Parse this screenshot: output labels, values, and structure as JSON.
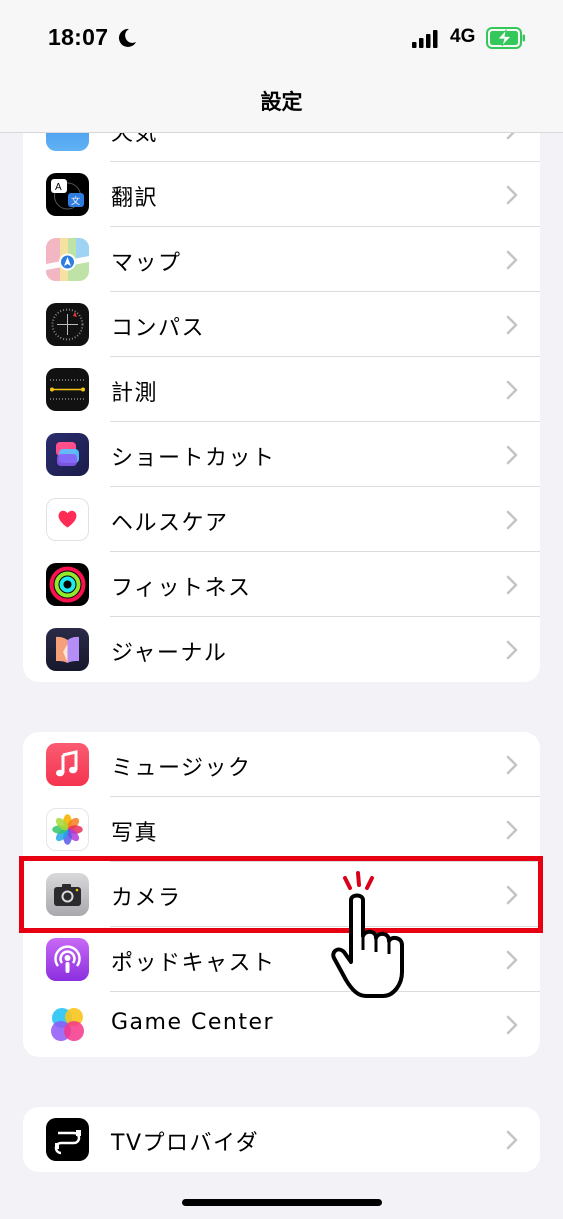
{
  "status_bar": {
    "time": "18:07",
    "network": "4G",
    "focus_icon": "moon-icon",
    "signal_icon": "signal-bars-icon",
    "battery_icon": "battery-charging-icon",
    "battery_color": "#34c759"
  },
  "nav": {
    "title": "設定"
  },
  "groups": [
    {
      "items": [
        {
          "label": "天気",
          "icon": "weather-icon"
        },
        {
          "label": "翻訳",
          "icon": "translate-icon"
        },
        {
          "label": "マップ",
          "icon": "maps-icon"
        },
        {
          "label": "コンパス",
          "icon": "compass-icon"
        },
        {
          "label": "計測",
          "icon": "measure-icon"
        },
        {
          "label": "ショートカット",
          "icon": "shortcuts-icon"
        },
        {
          "label": "ヘルスケア",
          "icon": "health-icon"
        },
        {
          "label": "フィットネス",
          "icon": "fitness-icon"
        },
        {
          "label": "ジャーナル",
          "icon": "journal-icon"
        }
      ]
    },
    {
      "items": [
        {
          "label": "ミュージック",
          "icon": "music-icon"
        },
        {
          "label": "写真",
          "icon": "photos-icon"
        },
        {
          "label": "カメラ",
          "icon": "camera-icon"
        },
        {
          "label": "ポッドキャスト",
          "icon": "podcasts-icon"
        },
        {
          "label": "Game Center",
          "icon": "game-center-icon"
        }
      ]
    },
    {
      "items": [
        {
          "label": "TVプロバイダ",
          "icon": "tv-provider-icon"
        }
      ]
    }
  ],
  "annotation": {
    "highlight_color": "#e60012",
    "highlighted_item": "カメラ",
    "pointer_icon": "tap-hand-icon"
  }
}
